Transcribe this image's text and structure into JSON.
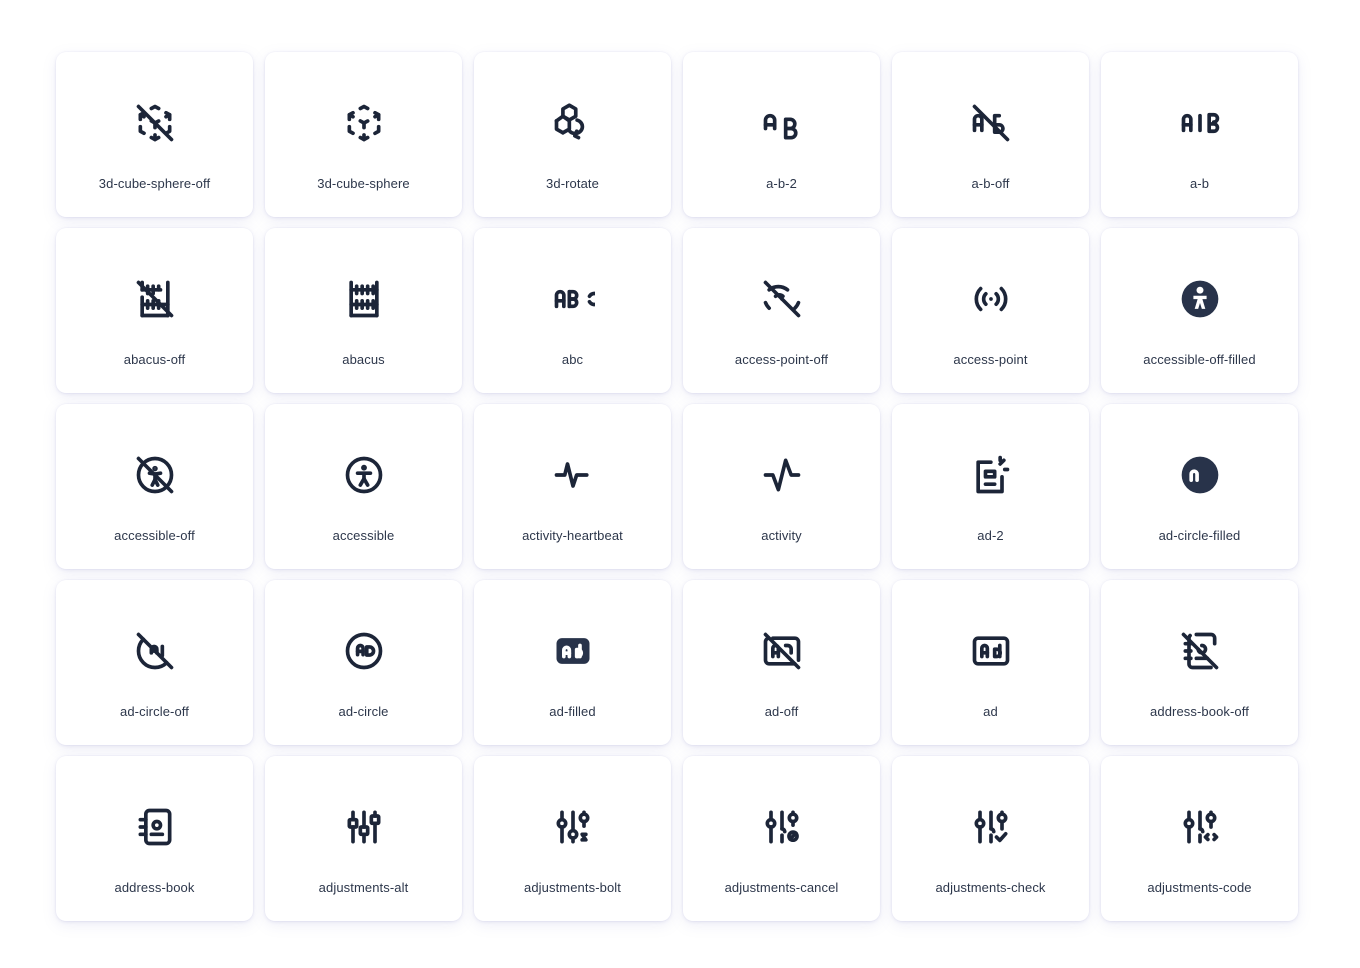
{
  "page": {
    "background_color": "#ffffff",
    "card_background": "#ffffff",
    "icon_stroke_color": "#1c2538",
    "icon_filled_color": "#28334a",
    "label_color": "#2d374b",
    "shadow_tint": "#e9e9f7",
    "columns": 6,
    "rows": 5
  },
  "icons": [
    {
      "name": "3d-cube-sphere-off",
      "label": "3d-cube-sphere-off",
      "glyph": "cube-sphere-off"
    },
    {
      "name": "3d-cube-sphere",
      "label": "3d-cube-sphere",
      "glyph": "cube-sphere"
    },
    {
      "name": "3d-rotate",
      "label": "3d-rotate",
      "glyph": "rotate-cube"
    },
    {
      "name": "a-b-2",
      "label": "a-b-2",
      "glyph": "ab2"
    },
    {
      "name": "a-b-off",
      "label": "a-b-off",
      "glyph": "ab-off"
    },
    {
      "name": "a-b",
      "label": "a-b",
      "glyph": "ab"
    },
    {
      "name": "abacus-off",
      "label": "abacus-off",
      "glyph": "abacus-off"
    },
    {
      "name": "abacus",
      "label": "abacus",
      "glyph": "abacus"
    },
    {
      "name": "abc",
      "label": "abc",
      "glyph": "abc"
    },
    {
      "name": "access-point-off",
      "label": "access-point-off",
      "glyph": "access-point-off"
    },
    {
      "name": "access-point",
      "label": "access-point",
      "glyph": "access-point"
    },
    {
      "name": "accessible-off-filled",
      "label": "accessible-off-filled",
      "glyph": "accessible-filled"
    },
    {
      "name": "accessible-off",
      "label": "accessible-off",
      "glyph": "accessible-off"
    },
    {
      "name": "accessible",
      "label": "accessible",
      "glyph": "accessible"
    },
    {
      "name": "activity-heartbeat",
      "label": "activity-heartbeat",
      "glyph": "activity-heartbeat"
    },
    {
      "name": "activity",
      "label": "activity",
      "glyph": "activity"
    },
    {
      "name": "ad-2",
      "label": "ad-2",
      "glyph": "ad-2"
    },
    {
      "name": "ad-circle-filled",
      "label": "ad-circle-filled",
      "glyph": "ad-circle-filled"
    },
    {
      "name": "ad-circle-off",
      "label": "ad-circle-off",
      "glyph": "ad-circle-off"
    },
    {
      "name": "ad-circle",
      "label": "ad-circle",
      "glyph": "ad-circle"
    },
    {
      "name": "ad-filled",
      "label": "ad-filled",
      "glyph": "ad-filled"
    },
    {
      "name": "ad-off",
      "label": "ad-off",
      "glyph": "ad-off"
    },
    {
      "name": "ad",
      "label": "ad",
      "glyph": "ad"
    },
    {
      "name": "address-book-off",
      "label": "address-book-off",
      "glyph": "address-book-off"
    },
    {
      "name": "address-book",
      "label": "address-book",
      "glyph": "address-book"
    },
    {
      "name": "adjustments-alt",
      "label": "adjustments-alt",
      "glyph": "adjustments-alt"
    },
    {
      "name": "adjustments-bolt",
      "label": "adjustments-bolt",
      "glyph": "adjustments-bolt"
    },
    {
      "name": "adjustments-cancel",
      "label": "adjustments-cancel",
      "glyph": "adjustments-cancel"
    },
    {
      "name": "adjustments-check",
      "label": "adjustments-check",
      "glyph": "adjustments-check"
    },
    {
      "name": "adjustments-code",
      "label": "adjustments-code",
      "glyph": "adjustments-code"
    }
  ]
}
